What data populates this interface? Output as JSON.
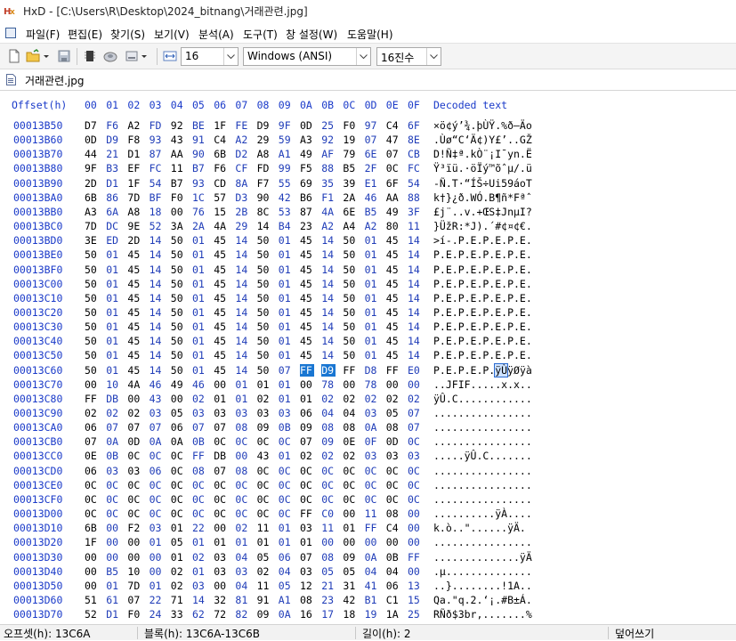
{
  "window": {
    "title": "HxD - [C:\\Users\\R\\Desktop\\2024_bitnang\\거래관련.jpg]"
  },
  "menu": [
    "파일(F)",
    "편집(E)",
    "찾기(S)",
    "보기(V)",
    "분석(A)",
    "도구(T)",
    "창 설정(W)",
    "도움말(H)"
  ],
  "toolbar": {
    "bytes_per_row": "16",
    "charset": "Windows (ANSI)",
    "offset_base": "16진수"
  },
  "tab": {
    "label": "거래관련.jpg"
  },
  "editor": {
    "offset_header": "Offset(h)",
    "columns": [
      "00",
      "01",
      "02",
      "03",
      "04",
      "05",
      "06",
      "07",
      "08",
      "09",
      "0A",
      "0B",
      "0C",
      "0D",
      "0E",
      "0F"
    ],
    "decoded_header": "Decoded text",
    "rows": [
      {
        "offset": "00013B50",
        "bytes": [
          "D7",
          "F6",
          "A2",
          "FD",
          "92",
          "BE",
          "1F",
          "FE",
          "D9",
          "9F",
          "0D",
          "25",
          "F0",
          "97",
          "C4",
          "6F"
        ],
        "text": "×ö¢ý’¾.þÙŸ.%ð—Äo"
      },
      {
        "offset": "00013B60",
        "bytes": [
          "0D",
          "D9",
          "F8",
          "93",
          "43",
          "91",
          "C4",
          "A2",
          "29",
          "59",
          "A3",
          "92",
          "19",
          "07",
          "47",
          "8E"
        ],
        "text": ".Ùø“C‘Ä¢)Y£’..GŽ"
      },
      {
        "offset": "00013B70",
        "bytes": [
          "44",
          "21",
          "D1",
          "87",
          "AA",
          "90",
          "6B",
          "D2",
          "A8",
          "A1",
          "49",
          "AF",
          "79",
          "6E",
          "07",
          "CB"
        ],
        "text": "D!Ñ‡ª.kÒ¨¡I¯yn.Ë"
      },
      {
        "offset": "00013B80",
        "bytes": [
          "9F",
          "B3",
          "EF",
          "FC",
          "11",
          "B7",
          "F6",
          "CF",
          "FD",
          "99",
          "F5",
          "88",
          "B5",
          "2F",
          "0C",
          "FC"
        ],
        "text": "Ÿ³ïü.·öÏý™õˆµ/.ü"
      },
      {
        "offset": "00013B90",
        "bytes": [
          "2D",
          "D1",
          "1F",
          "54",
          "B7",
          "93",
          "CD",
          "8A",
          "F7",
          "55",
          "69",
          "35",
          "39",
          "E1",
          "6F",
          "54"
        ],
        "text": "-Ñ.T·“ÍŠ÷Ui59áoT"
      },
      {
        "offset": "00013BA0",
        "bytes": [
          "6B",
          "86",
          "7D",
          "BF",
          "F0",
          "1C",
          "57",
          "D3",
          "90",
          "42",
          "B6",
          "F1",
          "2A",
          "46",
          "AA",
          "88"
        ],
        "text": "k†}¿ð.WÓ.B¶ñ*Fªˆ"
      },
      {
        "offset": "00013BB0",
        "bytes": [
          "A3",
          "6A",
          "A8",
          "18",
          "00",
          "76",
          "15",
          "2B",
          "8C",
          "53",
          "87",
          "4A",
          "6E",
          "B5",
          "49",
          "3F"
        ],
        "text": "£j¨..v.+ŒS‡JnµI?"
      },
      {
        "offset": "00013BC0",
        "bytes": [
          "7D",
          "DC",
          "9E",
          "52",
          "3A",
          "2A",
          "4A",
          "29",
          "14",
          "B4",
          "23",
          "A2",
          "A4",
          "A2",
          "80",
          "11"
        ],
        "text": "}ÜžR:*J).´#¢¤¢€."
      },
      {
        "offset": "00013BD0",
        "bytes": [
          "3E",
          "ED",
          "2D",
          "14",
          "50",
          "01",
          "45",
          "14",
          "50",
          "01",
          "45",
          "14",
          "50",
          "01",
          "45",
          "14"
        ],
        "text": ">í-.P.E.P.E.P.E."
      },
      {
        "offset": "00013BE0",
        "bytes": [
          "50",
          "01",
          "45",
          "14",
          "50",
          "01",
          "45",
          "14",
          "50",
          "01",
          "45",
          "14",
          "50",
          "01",
          "45",
          "14"
        ],
        "text": "P.E.P.E.P.E.P.E."
      },
      {
        "offset": "00013BF0",
        "bytes": [
          "50",
          "01",
          "45",
          "14",
          "50",
          "01",
          "45",
          "14",
          "50",
          "01",
          "45",
          "14",
          "50",
          "01",
          "45",
          "14"
        ],
        "text": "P.E.P.E.P.E.P.E."
      },
      {
        "offset": "00013C00",
        "bytes": [
          "50",
          "01",
          "45",
          "14",
          "50",
          "01",
          "45",
          "14",
          "50",
          "01",
          "45",
          "14",
          "50",
          "01",
          "45",
          "14"
        ],
        "text": "P.E.P.E.P.E.P.E."
      },
      {
        "offset": "00013C10",
        "bytes": [
          "50",
          "01",
          "45",
          "14",
          "50",
          "01",
          "45",
          "14",
          "50",
          "01",
          "45",
          "14",
          "50",
          "01",
          "45",
          "14"
        ],
        "text": "P.E.P.E.P.E.P.E."
      },
      {
        "offset": "00013C20",
        "bytes": [
          "50",
          "01",
          "45",
          "14",
          "50",
          "01",
          "45",
          "14",
          "50",
          "01",
          "45",
          "14",
          "50",
          "01",
          "45",
          "14"
        ],
        "text": "P.E.P.E.P.E.P.E."
      },
      {
        "offset": "00013C30",
        "bytes": [
          "50",
          "01",
          "45",
          "14",
          "50",
          "01",
          "45",
          "14",
          "50",
          "01",
          "45",
          "14",
          "50",
          "01",
          "45",
          "14"
        ],
        "text": "P.E.P.E.P.E.P.E."
      },
      {
        "offset": "00013C40",
        "bytes": [
          "50",
          "01",
          "45",
          "14",
          "50",
          "01",
          "45",
          "14",
          "50",
          "01",
          "45",
          "14",
          "50",
          "01",
          "45",
          "14"
        ],
        "text": "P.E.P.E.P.E.P.E."
      },
      {
        "offset": "00013C50",
        "bytes": [
          "50",
          "01",
          "45",
          "14",
          "50",
          "01",
          "45",
          "14",
          "50",
          "01",
          "45",
          "14",
          "50",
          "01",
          "45",
          "14"
        ],
        "text": "P.E.P.E.P.E.P.E."
      },
      {
        "offset": "00013C60",
        "bytes": [
          "50",
          "01",
          "45",
          "14",
          "50",
          "01",
          "45",
          "14",
          "50",
          "07",
          "FF",
          "D9",
          "FF",
          "D8",
          "FF",
          "E0"
        ],
        "text": "P.E.P.E.P.",
        "text_sel": "ÿÙ",
        "text_after": "ÿØÿà"
      },
      {
        "offset": "00013C70",
        "bytes": [
          "00",
          "10",
          "4A",
          "46",
          "49",
          "46",
          "00",
          "01",
          "01",
          "01",
          "00",
          "78",
          "00",
          "78",
          "00",
          "00"
        ],
        "text": "..JFIF.....x.x.."
      },
      {
        "offset": "00013C80",
        "bytes": [
          "FF",
          "DB",
          "00",
          "43",
          "00",
          "02",
          "01",
          "01",
          "02",
          "01",
          "01",
          "02",
          "02",
          "02",
          "02",
          "02"
        ],
        "text": "ÿÛ.C............"
      },
      {
        "offset": "00013C90",
        "bytes": [
          "02",
          "02",
          "02",
          "03",
          "05",
          "03",
          "03",
          "03",
          "03",
          "03",
          "06",
          "04",
          "04",
          "03",
          "05",
          "07"
        ],
        "text": "................"
      },
      {
        "offset": "00013CA0",
        "bytes": [
          "06",
          "07",
          "07",
          "07",
          "06",
          "07",
          "07",
          "08",
          "09",
          "0B",
          "09",
          "08",
          "08",
          "0A",
          "08",
          "07"
        ],
        "text": "................"
      },
      {
        "offset": "00013CB0",
        "bytes": [
          "07",
          "0A",
          "0D",
          "0A",
          "0A",
          "0B",
          "0C",
          "0C",
          "0C",
          "0C",
          "07",
          "09",
          "0E",
          "0F",
          "0D",
          "0C"
        ],
        "text": "................"
      },
      {
        "offset": "00013CC0",
        "bytes": [
          "0E",
          "0B",
          "0C",
          "0C",
          "0C",
          "FF",
          "DB",
          "00",
          "43",
          "01",
          "02",
          "02",
          "02",
          "03",
          "03",
          "03"
        ],
        "text": ".....ÿÛ.C......."
      },
      {
        "offset": "00013CD0",
        "bytes": [
          "06",
          "03",
          "03",
          "06",
          "0C",
          "08",
          "07",
          "08",
          "0C",
          "0C",
          "0C",
          "0C",
          "0C",
          "0C",
          "0C",
          "0C"
        ],
        "text": "................"
      },
      {
        "offset": "00013CE0",
        "bytes": [
          "0C",
          "0C",
          "0C",
          "0C",
          "0C",
          "0C",
          "0C",
          "0C",
          "0C",
          "0C",
          "0C",
          "0C",
          "0C",
          "0C",
          "0C",
          "0C"
        ],
        "text": "................"
      },
      {
        "offset": "00013CF0",
        "bytes": [
          "0C",
          "0C",
          "0C",
          "0C",
          "0C",
          "0C",
          "0C",
          "0C",
          "0C",
          "0C",
          "0C",
          "0C",
          "0C",
          "0C",
          "0C",
          "0C"
        ],
        "text": "................"
      },
      {
        "offset": "00013D00",
        "bytes": [
          "0C",
          "0C",
          "0C",
          "0C",
          "0C",
          "0C",
          "0C",
          "0C",
          "0C",
          "0C",
          "FF",
          "C0",
          "00",
          "11",
          "08",
          "00"
        ],
        "text": "..........ÿÀ...."
      },
      {
        "offset": "00013D10",
        "bytes": [
          "6B",
          "00",
          "F2",
          "03",
          "01",
          "22",
          "00",
          "02",
          "11",
          "01",
          "03",
          "11",
          "01",
          "FF",
          "C4",
          "00"
        ],
        "text": "k.ò..\"......ÿÄ."
      },
      {
        "offset": "00013D20",
        "bytes": [
          "1F",
          "00",
          "00",
          "01",
          "05",
          "01",
          "01",
          "01",
          "01",
          "01",
          "01",
          "00",
          "00",
          "00",
          "00",
          "00"
        ],
        "text": "................"
      },
      {
        "offset": "00013D30",
        "bytes": [
          "00",
          "00",
          "00",
          "00",
          "01",
          "02",
          "03",
          "04",
          "05",
          "06",
          "07",
          "08",
          "09",
          "0A",
          "0B",
          "FF",
          "C4"
        ],
        "text": "..............ÿÄ"
      },
      {
        "offset": "00013D40",
        "bytes": [
          "00",
          "B5",
          "10",
          "00",
          "02",
          "01",
          "03",
          "03",
          "02",
          "04",
          "03",
          "05",
          "05",
          "04",
          "04",
          "00"
        ],
        "text": ".µ.............."
      },
      {
        "offset": "00013D50",
        "bytes": [
          "00",
          "01",
          "7D",
          "01",
          "02",
          "03",
          "00",
          "04",
          "11",
          "05",
          "12",
          "21",
          "31",
          "41",
          "06",
          "13"
        ],
        "text": "..}........!1A.."
      },
      {
        "offset": "00013D60",
        "bytes": [
          "51",
          "61",
          "07",
          "22",
          "71",
          "14",
          "32",
          "81",
          "91",
          "A1",
          "08",
          "23",
          "42",
          "B1",
          "C1",
          "15"
        ],
        "text": "Qa.\"q.2.‘¡.#B±Á."
      },
      {
        "offset": "00013D70",
        "bytes": [
          "52",
          "D1",
          "F0",
          "24",
          "33",
          "62",
          "72",
          "82",
          "09",
          "0A",
          "16",
          "17",
          "18",
          "19",
          "1A",
          "25"
        ],
        "text": "RÑð$3br‚.......%"
      }
    ]
  },
  "status": {
    "offset": "오프셋(h): 13C6A",
    "block": "블록(h): 13C6A-13C6B",
    "length": "길이(h): 2",
    "mode": "덮어쓰기"
  },
  "colors": {
    "offset_blue": "#1a3ac9",
    "selection": "#1976d2"
  },
  "icons": [
    "app-icon",
    "menu-window-icon",
    "new-file-icon",
    "open-folder-icon",
    "save-icon",
    "chip-icon",
    "disk-icon",
    "drive-icon",
    "cols-arrow-icon",
    "tab-file-icon"
  ]
}
